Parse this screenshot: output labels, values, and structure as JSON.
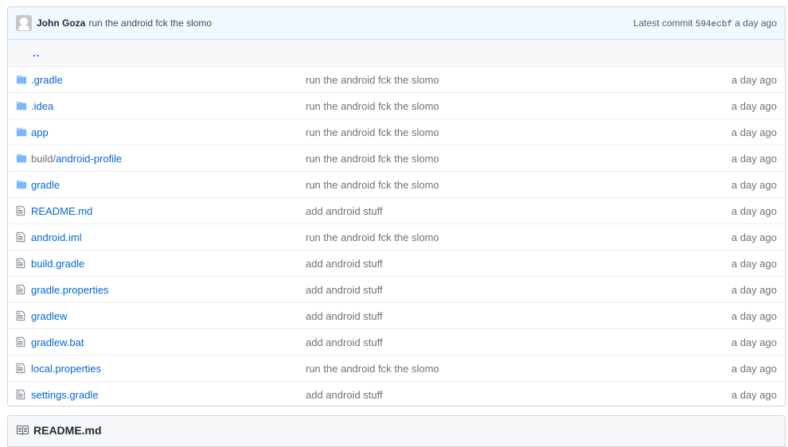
{
  "commit": {
    "author": "John Goza",
    "message": "run the android fck the slomo",
    "latest_label": "Latest commit",
    "sha": "594ecbf",
    "age": "a day ago",
    "avatar_icon": "github-default-avatar"
  },
  "up_dir": "..",
  "files": [
    {
      "type": "dir",
      "icon": "folder-icon",
      "prefix": "",
      "name": ".gradle",
      "message": "run the android fck the slomo",
      "age": "a day ago"
    },
    {
      "type": "dir",
      "icon": "folder-icon",
      "prefix": "",
      "name": ".idea",
      "message": "run the android fck the slomo",
      "age": "a day ago"
    },
    {
      "type": "dir",
      "icon": "folder-icon",
      "prefix": "",
      "name": "app",
      "message": "run the android fck the slomo",
      "age": "a day ago"
    },
    {
      "type": "dir",
      "icon": "folder-icon",
      "prefix": "build/",
      "name": "android-profile",
      "message": "run the android fck the slomo",
      "age": "a day ago"
    },
    {
      "type": "dir",
      "icon": "folder-icon",
      "prefix": "",
      "name": "gradle",
      "message": "run the android fck the slomo",
      "age": "a day ago"
    },
    {
      "type": "file",
      "icon": "file-icon",
      "prefix": "",
      "name": "README.md",
      "message": "add android stuff",
      "age": "a day ago"
    },
    {
      "type": "file",
      "icon": "file-icon",
      "prefix": "",
      "name": "android.iml",
      "message": "run the android fck the slomo",
      "age": "a day ago"
    },
    {
      "type": "file",
      "icon": "file-icon",
      "prefix": "",
      "name": "build.gradle",
      "message": "add android stuff",
      "age": "a day ago"
    },
    {
      "type": "file",
      "icon": "file-icon",
      "prefix": "",
      "name": "gradle.properties",
      "message": "add android stuff",
      "age": "a day ago"
    },
    {
      "type": "file",
      "icon": "file-icon",
      "prefix": "",
      "name": "gradlew",
      "message": "add android stuff",
      "age": "a day ago"
    },
    {
      "type": "file",
      "icon": "file-icon",
      "prefix": "",
      "name": "gradlew.bat",
      "message": "add android stuff",
      "age": "a day ago"
    },
    {
      "type": "file",
      "icon": "file-icon",
      "prefix": "",
      "name": "local.properties",
      "message": "run the android fck the slomo",
      "age": "a day ago"
    },
    {
      "type": "file",
      "icon": "file-icon",
      "prefix": "",
      "name": "settings.gradle",
      "message": "add android stuff",
      "age": "a day ago"
    }
  ],
  "readme": {
    "title": "README.md",
    "icon": "book-icon"
  },
  "colors": {
    "link": "#0366d6",
    "folder_icon": "#79b8ff",
    "muted": "#6a737d",
    "commit_bg": "#f1f8ff"
  }
}
